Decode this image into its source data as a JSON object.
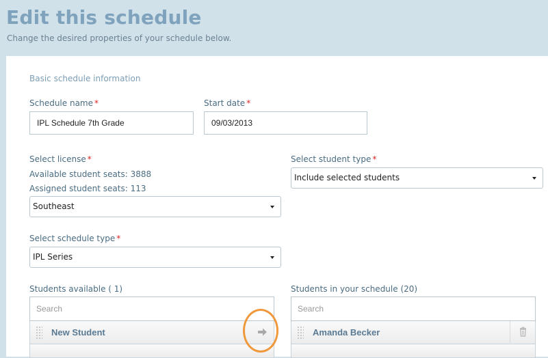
{
  "header": {
    "title": "Edit this schedule",
    "subtitle": "Change the desired properties of your schedule below."
  },
  "section_title": "Basic schedule information",
  "required_marker": "*",
  "schedule_name": {
    "label": "Schedule name",
    "value": "IPL Schedule 7th Grade"
  },
  "start_date": {
    "label": "Start date",
    "value": "09/03/2013"
  },
  "license": {
    "label": "Select license",
    "available_seats": "Available student seats: 3888",
    "assigned_seats": "Assigned student seats: 113",
    "selected": "Southeast"
  },
  "student_type": {
    "label": "Select student type",
    "selected": "Include selected students"
  },
  "schedule_type": {
    "label": "Select schedule type",
    "selected": "IPL Series"
  },
  "students_available": {
    "label": "Students available ( 1)",
    "search_placeholder": "Search",
    "items": [
      {
        "name": "New Student"
      }
    ]
  },
  "students_in_schedule": {
    "label": "Students in your schedule (20)",
    "search_placeholder": "Search",
    "items": [
      {
        "name": "Amanda Becker"
      }
    ]
  },
  "icons": {
    "move": "arrow-right-icon",
    "delete": "trash-icon",
    "drag": "drag-handle-icon"
  },
  "colors": {
    "title": "#7fa2bd",
    "background": "#d0e1ea",
    "required": "#dd2222",
    "highlight": "#f0983c"
  }
}
